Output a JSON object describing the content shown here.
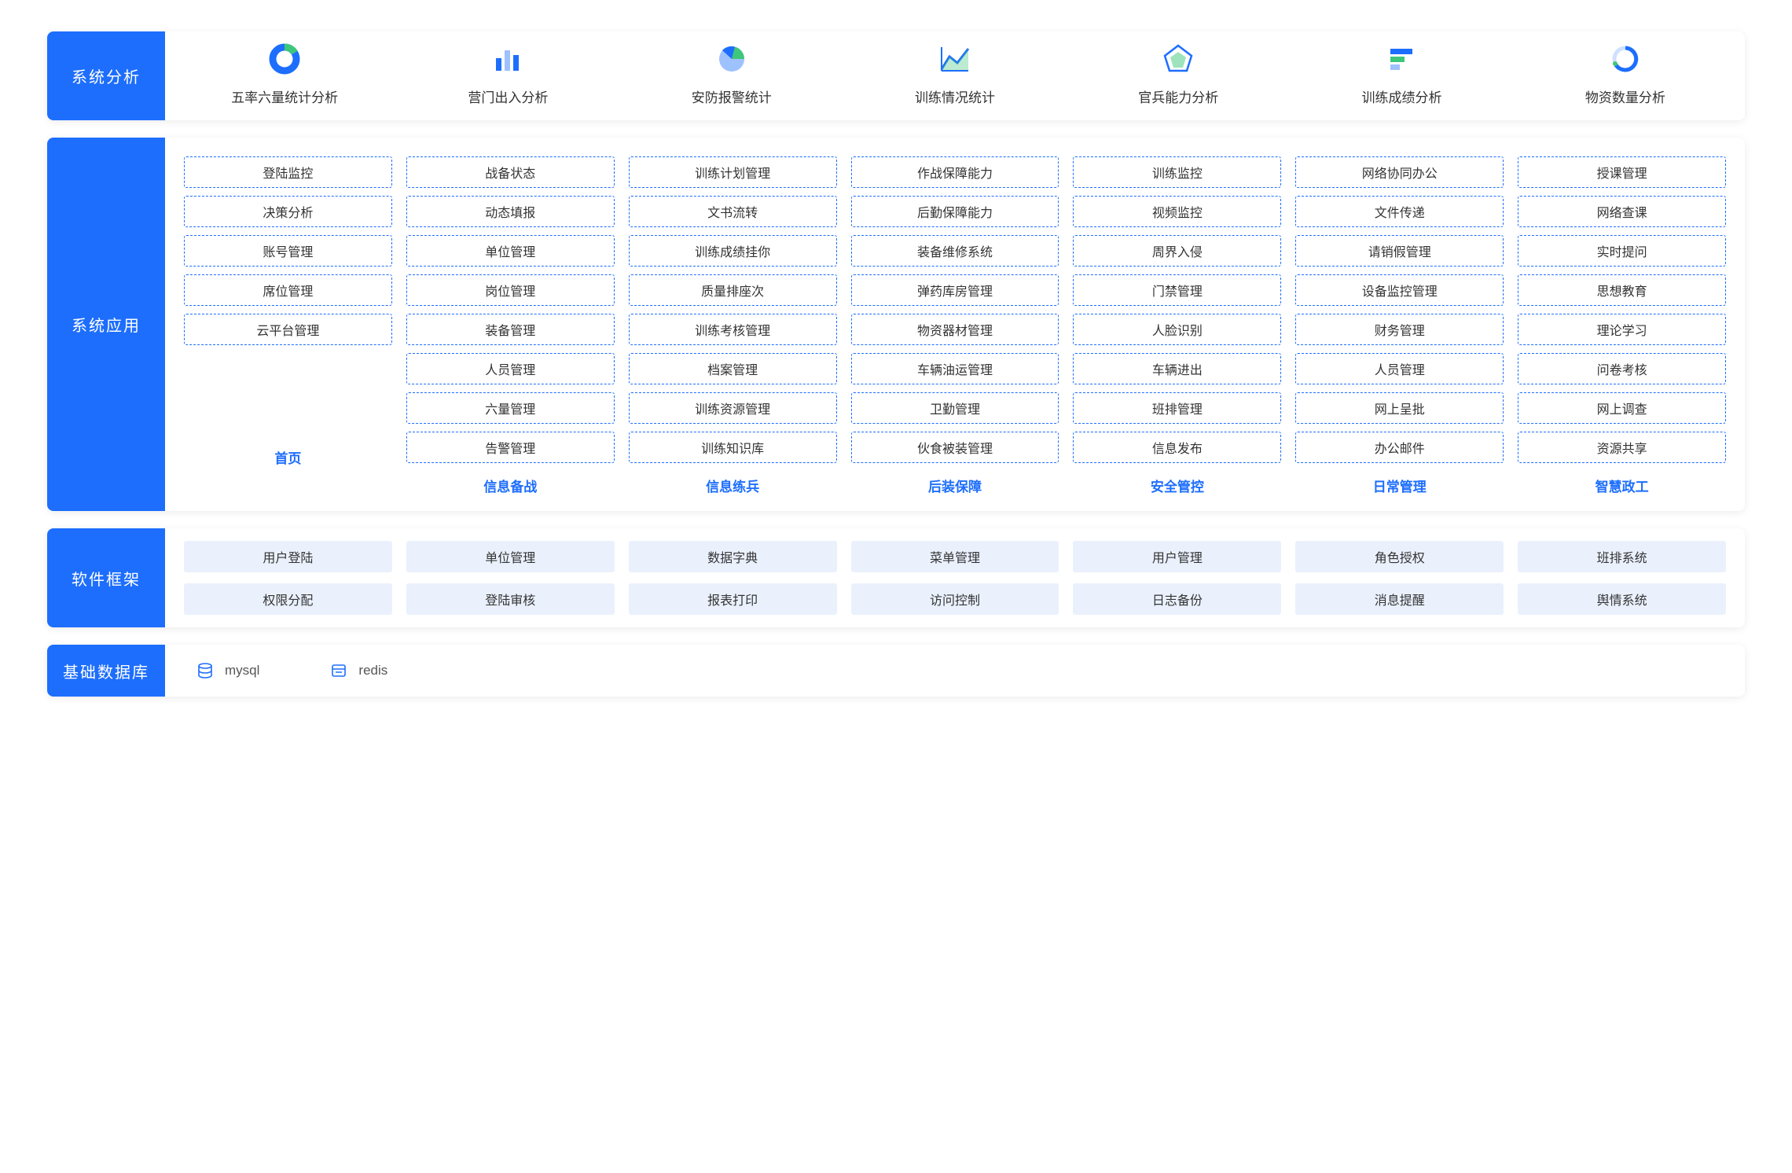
{
  "sections": {
    "analysis": {
      "label": "系统分析",
      "items": [
        {
          "icon": "donut",
          "label": "五率六量统计分析"
        },
        {
          "icon": "bars",
          "label": "营门出入分析"
        },
        {
          "icon": "pie",
          "label": "安防报警统计"
        },
        {
          "icon": "area",
          "label": "训练情况统计"
        },
        {
          "icon": "penta",
          "label": "官兵能力分析"
        },
        {
          "icon": "hbar",
          "label": "训练成绩分析"
        },
        {
          "icon": "ring",
          "label": "物资数量分析"
        }
      ]
    },
    "apps": {
      "label": "系统应用",
      "columns": [
        {
          "footer": "首页",
          "items": [
            "登陆监控",
            "决策分析",
            "账号管理",
            "席位管理",
            "云平台管理"
          ]
        },
        {
          "footer": "信息备战",
          "items": [
            "战备状态",
            "动态填报",
            "单位管理",
            "岗位管理",
            "装备管理",
            "人员管理",
            "六量管理",
            "告警管理"
          ]
        },
        {
          "footer": "信息练兵",
          "items": [
            "训练计划管理",
            "文书流转",
            "训练成绩挂你",
            "质量排座次",
            "训练考核管理",
            "档案管理",
            "训练资源管理",
            "训练知识库"
          ]
        },
        {
          "footer": "后装保障",
          "items": [
            "作战保障能力",
            "后勤保障能力",
            "装备维修系统",
            "弹药库房管理",
            "物资器材管理",
            "车辆油运管理",
            "卫勤管理",
            "伙食被装管理"
          ]
        },
        {
          "footer": "安全管控",
          "items": [
            "训练监控",
            "视频监控",
            "周界入侵",
            "门禁管理",
            "人脸识别",
            "车辆进出",
            "班排管理",
            "信息发布"
          ]
        },
        {
          "footer": "日常管理",
          "items": [
            "网络协同办公",
            "文件传递",
            "请销假管理",
            "设备监控管理",
            "财务管理",
            "人员管理",
            "网上呈批",
            "办公邮件"
          ]
        },
        {
          "footer": "智慧政工",
          "items": [
            "授课管理",
            "网络查课",
            "实时提问",
            "思想教育",
            "理论学习",
            "问卷考核",
            "网上调查",
            "资源共享"
          ]
        }
      ]
    },
    "framework": {
      "label": "软件框架",
      "items": [
        "用户登陆",
        "单位管理",
        "数据字典",
        "菜单管理",
        "用户管理",
        "角色授权",
        "班排系统",
        "权限分配",
        "登陆审核",
        "报表打印",
        "访问控制",
        "日志备份",
        "消息提醒",
        "舆情系统"
      ]
    },
    "database": {
      "label": "基础数据库",
      "items": [
        {
          "icon": "db",
          "label": "mysql"
        },
        {
          "icon": "cache",
          "label": "redis"
        }
      ]
    }
  },
  "colors": {
    "primary": "#1d6efd",
    "accent": "#3ec77a"
  }
}
